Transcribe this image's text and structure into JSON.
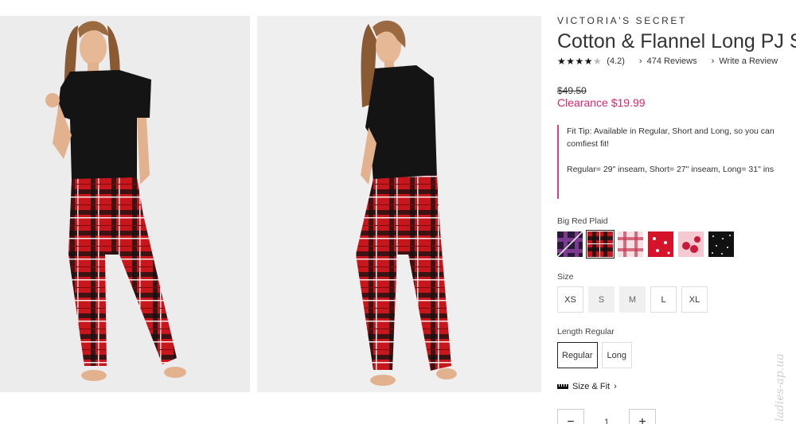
{
  "product": {
    "brand": "VICTORIA'S SECRET",
    "title": "Cotton & Flannel Long PJ S",
    "rating": {
      "stars": 4.2,
      "stars_display": "★★★★",
      "half_star": "★",
      "score_text": "(4.2)"
    },
    "reviews_link": "474 Reviews",
    "write_review_link": "Write a Review",
    "original_price": "$49.50",
    "sale_price": "Clearance $19.99"
  },
  "fit_tip": {
    "line1": "Fit Tip: Available in Regular, Short and Long, so you can",
    "line2": "comfiest fit!",
    "line3": "Regular= 29\" inseam, Short= 27\" inseam, Long= 31\" ins"
  },
  "color": {
    "label": "Big Red Plaid",
    "selected_index": 1,
    "swatches": [
      "purple-plaid",
      "big-red-plaid",
      "pink-plaid",
      "red-print",
      "cherry-print",
      "black-dots"
    ]
  },
  "size": {
    "label": "Size",
    "options": [
      {
        "label": "XS",
        "available": true
      },
      {
        "label": "S",
        "available": false
      },
      {
        "label": "M",
        "available": false
      },
      {
        "label": "L",
        "available": true
      },
      {
        "label": "XL",
        "available": true
      }
    ]
  },
  "length": {
    "label": "Length Regular",
    "options": [
      {
        "label": "Regular",
        "selected": true
      },
      {
        "label": "Long",
        "selected": false
      }
    ]
  },
  "size_fit_link": "Size & Fit",
  "quantity": {
    "minus": "−",
    "value": "1",
    "plus": "+"
  },
  "watermark": "ladies-ap.ua",
  "colors": {
    "sale": "#d6276f",
    "fit_tip_border": "#e0407f",
    "plaid_red": "#c8161d"
  },
  "icons": {
    "chevron": "chevron-right-icon",
    "ruler": "ruler-icon"
  }
}
